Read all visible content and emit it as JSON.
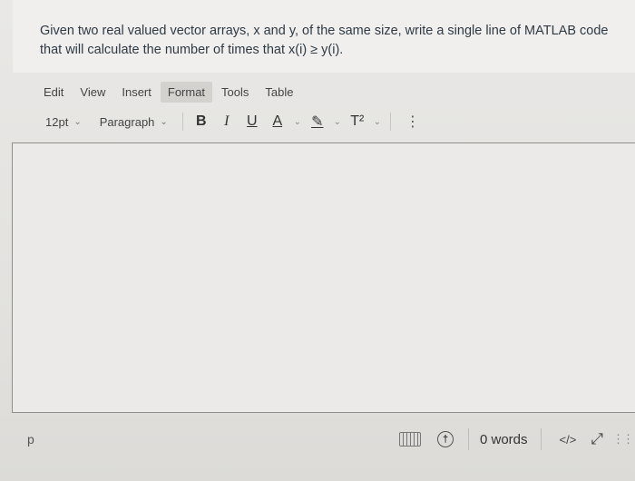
{
  "question": {
    "text": "Given two real valued vector arrays, x and y, of the same size, write a single line of MATLAB code that will calculate the number of times that x(i) ≥ y(i)."
  },
  "menubar": {
    "items": [
      {
        "label": "Edit"
      },
      {
        "label": "View"
      },
      {
        "label": "Insert"
      },
      {
        "label": "Format"
      },
      {
        "label": "Tools"
      },
      {
        "label": "Table"
      }
    ]
  },
  "toolbar": {
    "font_size": "12pt",
    "block_format": "Paragraph",
    "bold": "B",
    "italic": "I",
    "underline": "U",
    "text_color": "A",
    "highlight": "✎",
    "superscript": "T²",
    "more": "⋮"
  },
  "editor": {
    "content": ""
  },
  "statusbar": {
    "path": "p",
    "word_count": "0 words",
    "html_toggle": "</>"
  },
  "icons": {
    "keyboard": "keyboard-icon",
    "accessibility": "accessibility-icon",
    "expand": "expand-icon",
    "grip": "resize-grip-icon"
  }
}
